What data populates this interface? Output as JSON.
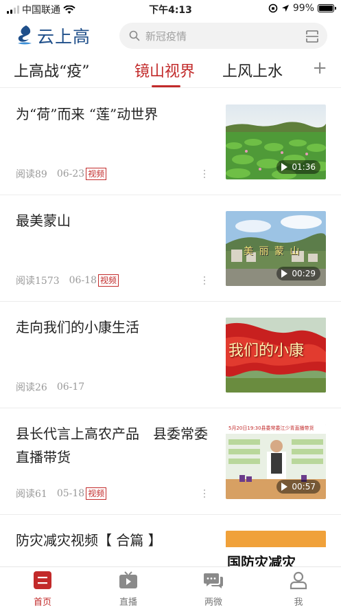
{
  "status_bar": {
    "carrier": "中国联通",
    "time": "下午4:13",
    "battery": "99%",
    "battery_level": 0.99
  },
  "header": {
    "app_title": "云上高",
    "search_placeholder": "新冠疫情"
  },
  "tabs": [
    {
      "label": "上高战“疫”",
      "active": false
    },
    {
      "label": "镜山视界",
      "active": true
    },
    {
      "label": "上风上水",
      "active": false
    }
  ],
  "articles": [
    {
      "title": "为“荷”而来 “莲”动世界",
      "reads": "阅读89",
      "date": "06-23",
      "badge": "视频",
      "duration": "01:36"
    },
    {
      "title": "最美蒙山",
      "reads": "阅读1573",
      "date": "06-18",
      "badge": "视频",
      "duration": "00:29",
      "overlay_text": "美 丽 蒙 山"
    },
    {
      "title": "走向我们的小康生活",
      "reads": "阅读26",
      "date": "06-17",
      "overlay_text": "我们的小康"
    },
    {
      "title": "县长代言上高农产品　县委常委直播带货",
      "reads": "阅读61",
      "date": "05-18",
      "badge": "视频",
      "duration": "00:57",
      "overlay_text": "5月20日19:30县委常委江少青直播带货"
    },
    {
      "title": "防灾减灾视频【 合篇 】",
      "overlay_text": "国防灾减灾"
    }
  ],
  "bottom_nav": [
    {
      "label": "首页",
      "icon": "home-icon",
      "active": true
    },
    {
      "label": "直播",
      "icon": "tv-icon",
      "active": false
    },
    {
      "label": "两微",
      "icon": "chat-icon",
      "active": false
    },
    {
      "label": "我",
      "icon": "user-icon",
      "active": false
    }
  ],
  "colors": {
    "accent": "#c22a2a",
    "brand": "#1f4f8a"
  }
}
